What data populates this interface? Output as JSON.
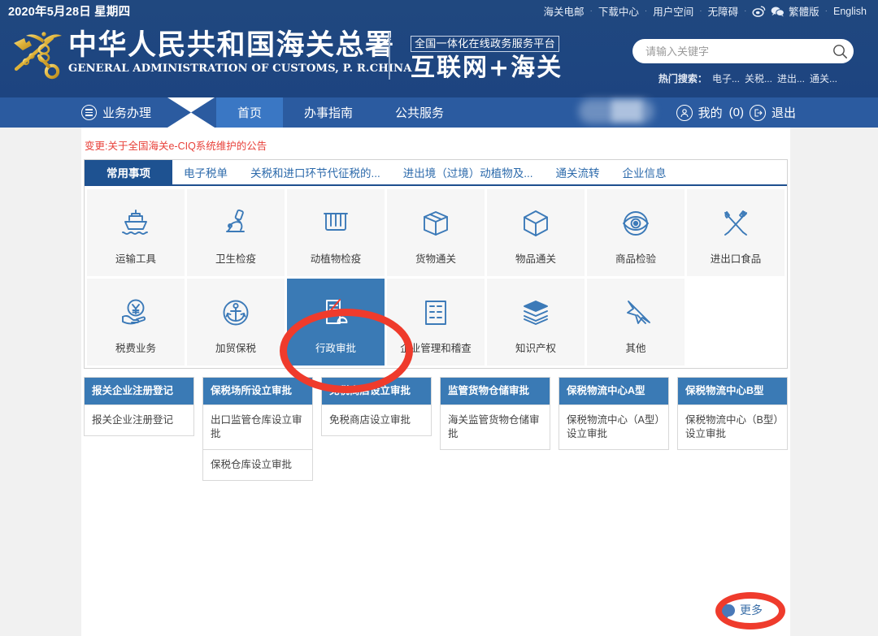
{
  "header": {
    "date": "2020年5月28日  星期四",
    "toplinks": [
      {
        "label": "海关电邮",
        "type": "text"
      },
      {
        "label": "下载中心",
        "type": "text"
      },
      {
        "label": "用户空间",
        "type": "text"
      },
      {
        "label": "无障碍",
        "type": "text"
      },
      {
        "label": "weibo-icon",
        "type": "icon"
      },
      {
        "label": "wechat-icon",
        "type": "icon"
      },
      {
        "label": "繁體版",
        "type": "text"
      },
      {
        "label": "English",
        "type": "text"
      }
    ],
    "separator": "·",
    "brand_cn": "中华人民共和国海关总署",
    "brand_en": "GENERAL ADMINISTRATION OF CUSTOMS, P. R.CHINA",
    "platform_tag": "全国一体化在线政务服务平台",
    "platform_main": "互联网+海关",
    "emblem_name": "customs-emblem-icon"
  },
  "search": {
    "placeholder": "请输入关键字",
    "value": "",
    "icon": "search-icon",
    "hot_label": "热门搜索：",
    "hot_items": [
      "电子...",
      "关税...",
      "进出...",
      "通关..."
    ]
  },
  "nav": {
    "menu_label": "业务办理",
    "menu_icon": "hamburger-circle-icon",
    "tabs": [
      {
        "label": "首页",
        "active": true
      },
      {
        "label": "办事指南",
        "active": false
      },
      {
        "label": "公共服务",
        "active": false
      }
    ],
    "username_masked": "",
    "mine_label": "我的",
    "mine_count": "(0)",
    "mine_icon": "user-circle-icon",
    "logout_label": "退出",
    "logout_icon": "logout-circle-icon"
  },
  "notice": {
    "text": "变更:关于全国海关e-CIQ系统维护的公告"
  },
  "tabs": [
    {
      "label": "常用事项",
      "active": true
    },
    {
      "label": "电子税单",
      "active": false
    },
    {
      "label": "关税和进口环节代征税的...",
      "active": false
    },
    {
      "label": "进出境（过境）动植物及...",
      "active": false
    },
    {
      "label": "通关流转",
      "active": false
    },
    {
      "label": "企业信息",
      "active": false
    }
  ],
  "grid": [
    {
      "label": "运输工具",
      "icon": "ship-icon",
      "selected": false
    },
    {
      "label": "卫生检疫",
      "icon": "microscope-icon",
      "selected": false
    },
    {
      "label": "动植物检疫",
      "icon": "test-tubes-icon",
      "selected": false
    },
    {
      "label": "货物通关",
      "icon": "open-box-icon",
      "selected": false
    },
    {
      "label": "物品通关",
      "icon": "cube-icon",
      "selected": false
    },
    {
      "label": "商品检验",
      "icon": "eye-inspection-icon",
      "selected": false
    },
    {
      "label": "进出口食品",
      "icon": "fork-knife-icon",
      "selected": false
    },
    {
      "label": "税费业务",
      "icon": "hand-yuan-icon",
      "selected": false
    },
    {
      "label": "加贸保税",
      "icon": "anchor-icon",
      "selected": false
    },
    {
      "label": "行政审批",
      "icon": "document-approval-icon",
      "selected": true
    },
    {
      "label": "企业管理和稽查",
      "icon": "building-icon",
      "selected": false
    },
    {
      "label": "知识产权",
      "icon": "books-icon",
      "selected": false
    },
    {
      "label": "其他",
      "icon": "pushpin-icon",
      "selected": false
    },
    {
      "label": "",
      "icon": "",
      "selected": false,
      "empty": true
    }
  ],
  "cards": [
    {
      "title": "报关企业注册登记",
      "items": [
        "报关企业注册登记"
      ]
    },
    {
      "title": "保税场所设立审批",
      "items": [
        "出口监管仓库设立审批",
        "保税仓库设立审批"
      ]
    },
    {
      "title": "免税商店设立审批",
      "items": [
        "免税商店设立审批"
      ]
    },
    {
      "title": "监管货物仓储审批",
      "items": [
        "海关监管货物仓储审批"
      ]
    },
    {
      "title": "保税物流中心A型",
      "items": [
        "保税物流中心（A型）设立审批"
      ]
    },
    {
      "title": "保税物流中心B型",
      "items": [
        "保税物流中心（B型）设立审批"
      ]
    }
  ],
  "more": {
    "label": "更多",
    "icon": "speech-bubble-icon"
  },
  "annotations": {
    "tile_highlight": "行政审批",
    "more_highlight": "更多",
    "color": "#ef3b2c"
  },
  "colors": {
    "header_blue": "#1f4a84",
    "nav_blue": "#2b5ba0",
    "active_tab_blue": "#3a77c4",
    "tile_selected": "#3a7ab5",
    "card_head": "#3a7ab5",
    "notice_red": "#e8413a",
    "annotation_red": "#ef3b2c",
    "page_bg": "#f1f1f1",
    "tile_bg": "#f6f6f6"
  }
}
